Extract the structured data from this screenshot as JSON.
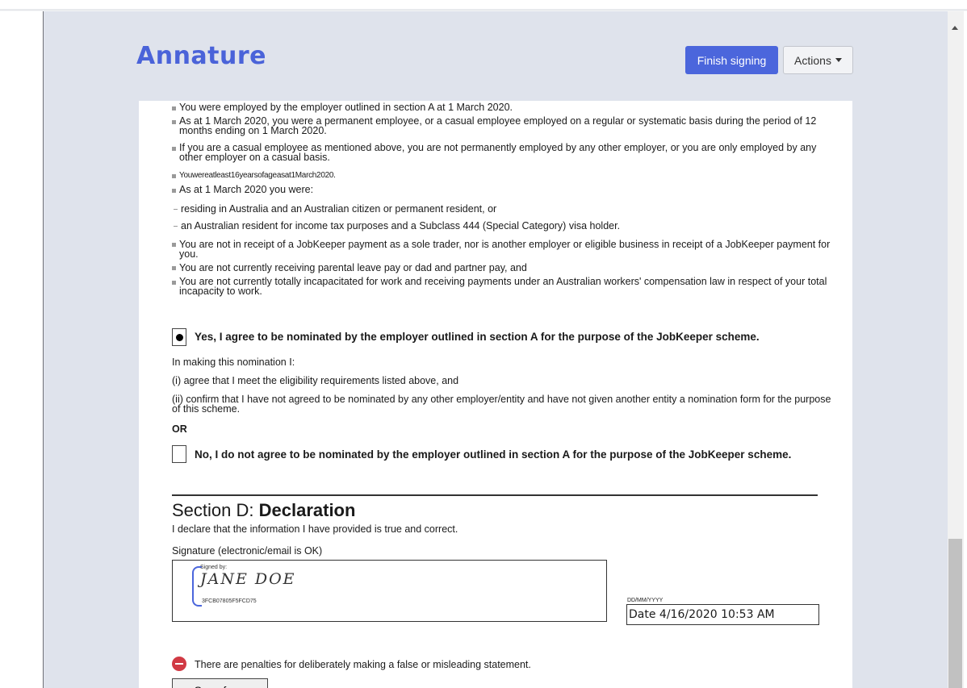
{
  "app": {
    "logo": "Annature"
  },
  "toolbar": {
    "finish_label": "Finish signing",
    "actions_label": "Actions"
  },
  "form": {
    "bullets": [
      "You were employed by the employer outlined in section A at 1 March 2020.",
      "As at 1 March 2020, you were a permanent employee, or a casual employee employed on a regular or systematic basis during the period of 12 months ending on 1 March 2020.",
      "If you are a casual employee as mentioned above, you are not permanently employed by any other employer, or you are only employed by any other employer on a casual basis.",
      "Youwereatleast16yearsofageasat1March2020.",
      "As at 1 March 2020 you were:",
      "You are not in receipt of a JobKeeper payment as a sole trader, nor is another employer or eligible business in receipt of a JobKeeper payment for you.",
      "You are not currently receiving parental leave pay or dad and partner pay, and",
      "You are not currently totally incapacitated for work and receiving payments under an Australian workers' compensation law in respect of your total incapacity to work."
    ],
    "sub_bullets": [
      "residing in Australia and an Australian citizen or permanent resident, or",
      "an Australian resident for income tax purposes and a Subclass 444 (Special Category) visa holder."
    ],
    "option_yes": "Yes, I agree to be nominated by the employer outlined in section A for the purpose of the JobKeeper scheme.",
    "option_yes_selected": true,
    "nomination_intro": "In making this nomination I:",
    "nomination_i": "(i) agree that I meet the eligibility requirements listed above, and",
    "nomination_ii": "(ii) confirm that I have not agreed to be nominated by any other employer/entity and have not given another entity a nomination form for the purpose of this scheme.",
    "or_label": "OR",
    "option_no": "No, I do not agree to be nominated by the employer outlined in section A for the purpose of the JobKeeper scheme.",
    "option_no_selected": false,
    "section_prefix": "Section D: ",
    "section_title": "Declaration",
    "declare_text": "I declare that the information I have provided is true and correct.",
    "signature_label": "Signature (electronic/email is OK)",
    "signature": {
      "signed_by": "Signed by:",
      "name": "JANE DOE",
      "id": "3FCB07805F5FCD75"
    },
    "date_format": "DD/MM/YYYY",
    "date_value": "Date  4/16/2020 10:53 AM",
    "warning": "There are penalties for deliberately making a false or misleading statement.",
    "save_label": "Save form"
  },
  "colors": {
    "accent": "#4b66dc",
    "warning": "#d13a44",
    "viewer_bg": "#dfe3ec"
  }
}
